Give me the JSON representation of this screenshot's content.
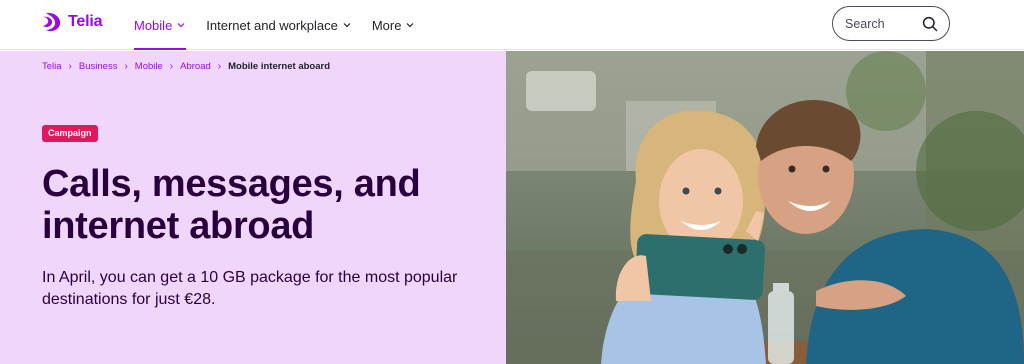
{
  "brand": {
    "name": "Telia",
    "color": "#990ae3"
  },
  "nav": {
    "items": [
      {
        "label": "Mobile",
        "active": true
      },
      {
        "label": "Internet and workplace",
        "active": false
      },
      {
        "label": "More",
        "active": false
      }
    ]
  },
  "search": {
    "placeholder": "Search",
    "icon": "search-icon"
  },
  "breadcrumb": {
    "items": [
      "Telia",
      "Business",
      "Mobile",
      "Abroad"
    ],
    "current": "Mobile internet aboard"
  },
  "hero": {
    "badge": "Campaign",
    "title": "Calls, messages, and internet abroad",
    "description": "In April, you can get a 10 GB package for the most popular destinations for just €28.",
    "background": "#f1d6fb",
    "badge_color": "#e4175c"
  }
}
